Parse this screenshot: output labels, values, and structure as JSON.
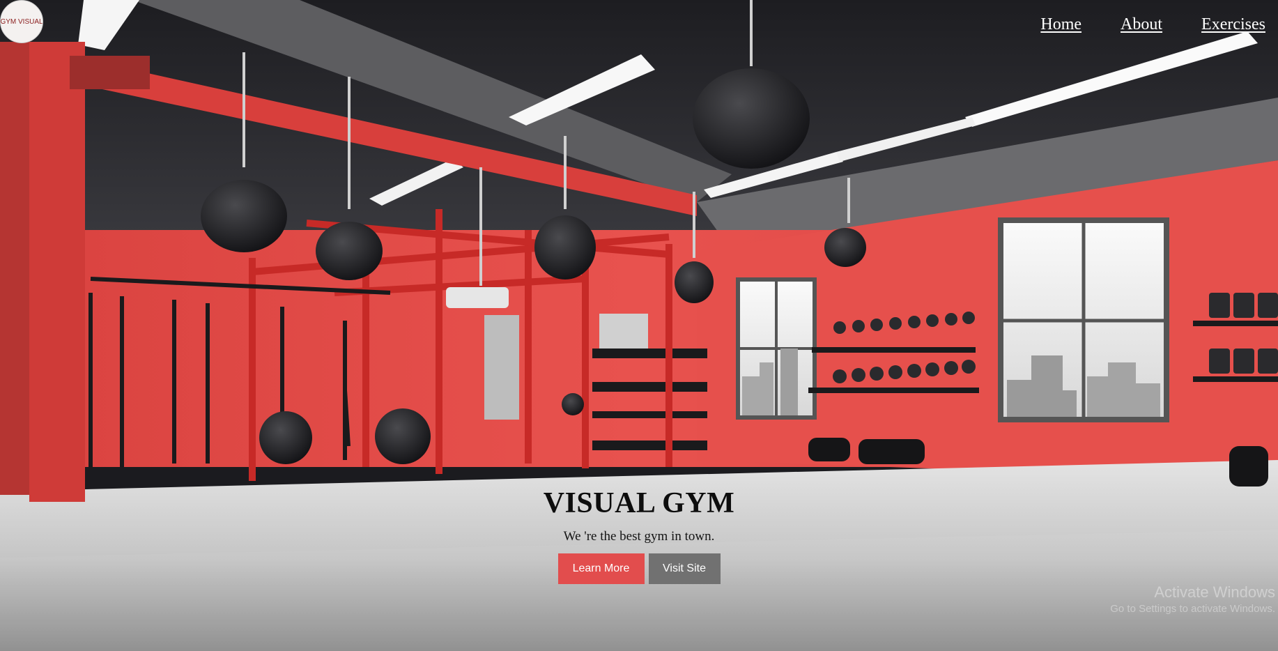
{
  "header": {
    "logo_text": "GYM VISUAL",
    "nav": [
      {
        "label": "Home"
      },
      {
        "label": "About"
      },
      {
        "label": "Exercises"
      }
    ]
  },
  "hero": {
    "title": "VISUAL GYM",
    "tagline": "We 're the best gym in town.",
    "primary_button": "Learn More",
    "secondary_button": "Visit Site",
    "background_image": "red and grey gym interior with hanging punching bags, red rigs, dumbbell racks and windows"
  },
  "os_watermark": {
    "line1": "Activate Windows",
    "line2": "Go to Settings to activate Windows."
  },
  "colors": {
    "accent": "#e24d4d",
    "secondary_button": "#717171",
    "wall_red": "#e04a4a",
    "floor_grey": "#c9c9c9",
    "ceiling_dark": "#2a2a2e",
    "nav_text": "#ffffff",
    "title_text": "#0d0d0d"
  }
}
